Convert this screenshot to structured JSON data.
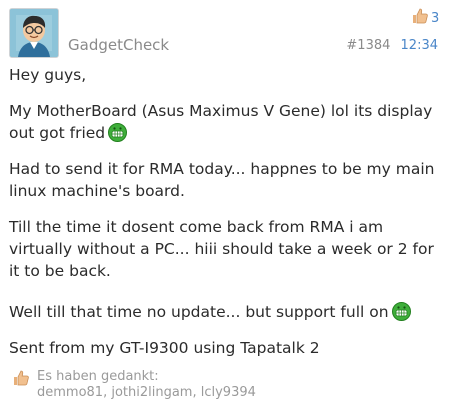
{
  "post": {
    "username": "GadgetCheck",
    "post_number": "#1384",
    "time": "12:34",
    "like_count": "3",
    "greeting": "Hey guys,",
    "p1": "My MotherBoard (Asus Maximus V Gene) lol its display out got fried",
    "p2": "Had to send it for RMA today... happnes to be my main linux machine's board.",
    "p3": "Till the time it dosent come back from RMA i am virtually without a PC... hiii should take a week or 2 for it to be back.",
    "p4": "Well till that time no update... but support full on",
    "signature": "Sent from my GT-I9300 using Tapatalk 2"
  },
  "thanks": {
    "label": "Es haben gedankt:",
    "users": "demmo81, jothi2lingam, lcly9394"
  },
  "icons": {
    "like": "thumbs-up-icon",
    "emoji": "grin-emoji-icon",
    "thanks": "thumbs-up-icon"
  },
  "colors": {
    "accent": "#4a86c8",
    "muted": "#8a8a8a",
    "thumb": "#e8b07a",
    "emoji": "#3fae3b"
  }
}
